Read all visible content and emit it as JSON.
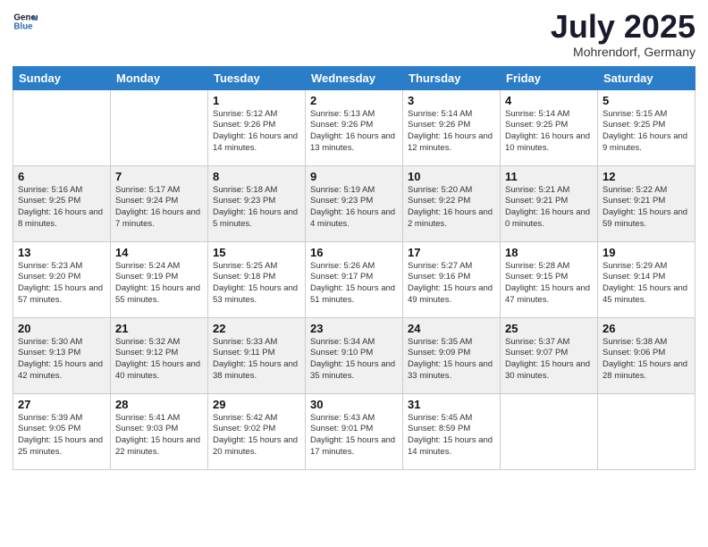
{
  "header": {
    "logo_line1": "General",
    "logo_line2": "Blue",
    "month": "July 2025",
    "location": "Mohrendorf, Germany"
  },
  "days_of_week": [
    "Sunday",
    "Monday",
    "Tuesday",
    "Wednesday",
    "Thursday",
    "Friday",
    "Saturday"
  ],
  "weeks": [
    [
      {
        "day": "",
        "sunrise": "",
        "sunset": "",
        "daylight": ""
      },
      {
        "day": "",
        "sunrise": "",
        "sunset": "",
        "daylight": ""
      },
      {
        "day": "1",
        "sunrise": "Sunrise: 5:12 AM",
        "sunset": "Sunset: 9:26 PM",
        "daylight": "Daylight: 16 hours and 14 minutes."
      },
      {
        "day": "2",
        "sunrise": "Sunrise: 5:13 AM",
        "sunset": "Sunset: 9:26 PM",
        "daylight": "Daylight: 16 hours and 13 minutes."
      },
      {
        "day": "3",
        "sunrise": "Sunrise: 5:14 AM",
        "sunset": "Sunset: 9:26 PM",
        "daylight": "Daylight: 16 hours and 12 minutes."
      },
      {
        "day": "4",
        "sunrise": "Sunrise: 5:14 AM",
        "sunset": "Sunset: 9:25 PM",
        "daylight": "Daylight: 16 hours and 10 minutes."
      },
      {
        "day": "5",
        "sunrise": "Sunrise: 5:15 AM",
        "sunset": "Sunset: 9:25 PM",
        "daylight": "Daylight: 16 hours and 9 minutes."
      }
    ],
    [
      {
        "day": "6",
        "sunrise": "Sunrise: 5:16 AM",
        "sunset": "Sunset: 9:25 PM",
        "daylight": "Daylight: 16 hours and 8 minutes."
      },
      {
        "day": "7",
        "sunrise": "Sunrise: 5:17 AM",
        "sunset": "Sunset: 9:24 PM",
        "daylight": "Daylight: 16 hours and 7 minutes."
      },
      {
        "day": "8",
        "sunrise": "Sunrise: 5:18 AM",
        "sunset": "Sunset: 9:23 PM",
        "daylight": "Daylight: 16 hours and 5 minutes."
      },
      {
        "day": "9",
        "sunrise": "Sunrise: 5:19 AM",
        "sunset": "Sunset: 9:23 PM",
        "daylight": "Daylight: 16 hours and 4 minutes."
      },
      {
        "day": "10",
        "sunrise": "Sunrise: 5:20 AM",
        "sunset": "Sunset: 9:22 PM",
        "daylight": "Daylight: 16 hours and 2 minutes."
      },
      {
        "day": "11",
        "sunrise": "Sunrise: 5:21 AM",
        "sunset": "Sunset: 9:21 PM",
        "daylight": "Daylight: 16 hours and 0 minutes."
      },
      {
        "day": "12",
        "sunrise": "Sunrise: 5:22 AM",
        "sunset": "Sunset: 9:21 PM",
        "daylight": "Daylight: 15 hours and 59 minutes."
      }
    ],
    [
      {
        "day": "13",
        "sunrise": "Sunrise: 5:23 AM",
        "sunset": "Sunset: 9:20 PM",
        "daylight": "Daylight: 15 hours and 57 minutes."
      },
      {
        "day": "14",
        "sunrise": "Sunrise: 5:24 AM",
        "sunset": "Sunset: 9:19 PM",
        "daylight": "Daylight: 15 hours and 55 minutes."
      },
      {
        "day": "15",
        "sunrise": "Sunrise: 5:25 AM",
        "sunset": "Sunset: 9:18 PM",
        "daylight": "Daylight: 15 hours and 53 minutes."
      },
      {
        "day": "16",
        "sunrise": "Sunrise: 5:26 AM",
        "sunset": "Sunset: 9:17 PM",
        "daylight": "Daylight: 15 hours and 51 minutes."
      },
      {
        "day": "17",
        "sunrise": "Sunrise: 5:27 AM",
        "sunset": "Sunset: 9:16 PM",
        "daylight": "Daylight: 15 hours and 49 minutes."
      },
      {
        "day": "18",
        "sunrise": "Sunrise: 5:28 AM",
        "sunset": "Sunset: 9:15 PM",
        "daylight": "Daylight: 15 hours and 47 minutes."
      },
      {
        "day": "19",
        "sunrise": "Sunrise: 5:29 AM",
        "sunset": "Sunset: 9:14 PM",
        "daylight": "Daylight: 15 hours and 45 minutes."
      }
    ],
    [
      {
        "day": "20",
        "sunrise": "Sunrise: 5:30 AM",
        "sunset": "Sunset: 9:13 PM",
        "daylight": "Daylight: 15 hours and 42 minutes."
      },
      {
        "day": "21",
        "sunrise": "Sunrise: 5:32 AM",
        "sunset": "Sunset: 9:12 PM",
        "daylight": "Daylight: 15 hours and 40 minutes."
      },
      {
        "day": "22",
        "sunrise": "Sunrise: 5:33 AM",
        "sunset": "Sunset: 9:11 PM",
        "daylight": "Daylight: 15 hours and 38 minutes."
      },
      {
        "day": "23",
        "sunrise": "Sunrise: 5:34 AM",
        "sunset": "Sunset: 9:10 PM",
        "daylight": "Daylight: 15 hours and 35 minutes."
      },
      {
        "day": "24",
        "sunrise": "Sunrise: 5:35 AM",
        "sunset": "Sunset: 9:09 PM",
        "daylight": "Daylight: 15 hours and 33 minutes."
      },
      {
        "day": "25",
        "sunrise": "Sunrise: 5:37 AM",
        "sunset": "Sunset: 9:07 PM",
        "daylight": "Daylight: 15 hours and 30 minutes."
      },
      {
        "day": "26",
        "sunrise": "Sunrise: 5:38 AM",
        "sunset": "Sunset: 9:06 PM",
        "daylight": "Daylight: 15 hours and 28 minutes."
      }
    ],
    [
      {
        "day": "27",
        "sunrise": "Sunrise: 5:39 AM",
        "sunset": "Sunset: 9:05 PM",
        "daylight": "Daylight: 15 hours and 25 minutes."
      },
      {
        "day": "28",
        "sunrise": "Sunrise: 5:41 AM",
        "sunset": "Sunset: 9:03 PM",
        "daylight": "Daylight: 15 hours and 22 minutes."
      },
      {
        "day": "29",
        "sunrise": "Sunrise: 5:42 AM",
        "sunset": "Sunset: 9:02 PM",
        "daylight": "Daylight: 15 hours and 20 minutes."
      },
      {
        "day": "30",
        "sunrise": "Sunrise: 5:43 AM",
        "sunset": "Sunset: 9:01 PM",
        "daylight": "Daylight: 15 hours and 17 minutes."
      },
      {
        "day": "31",
        "sunrise": "Sunrise: 5:45 AM",
        "sunset": "Sunset: 8:59 PM",
        "daylight": "Daylight: 15 hours and 14 minutes."
      },
      {
        "day": "",
        "sunrise": "",
        "sunset": "",
        "daylight": ""
      },
      {
        "day": "",
        "sunrise": "",
        "sunset": "",
        "daylight": ""
      }
    ]
  ]
}
